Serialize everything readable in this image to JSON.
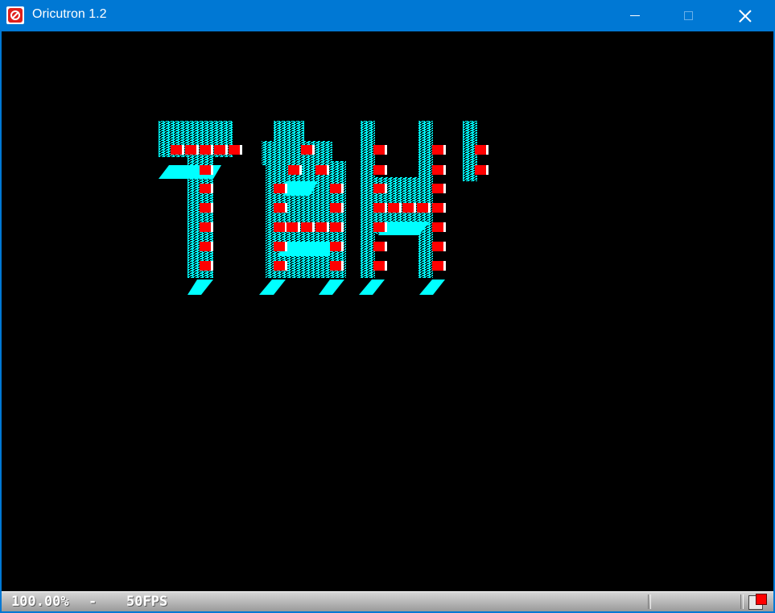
{
  "window": {
    "title": "Oricutron 1.2",
    "icon": "oricutron-app-icon"
  },
  "controls": {
    "minimize_icon": "minimize-icon",
    "maximize_icon": "maximize-icon",
    "close_icon": "close-icon"
  },
  "screen": {
    "banner_text": "TẢH",
    "colors": {
      "background": "#000000",
      "pattern": "#00ffff",
      "brick": "#ff0000",
      "highlight": "#ffffff"
    }
  },
  "status": {
    "speed": "100.00%",
    "separator": "-",
    "fps": "50FPS",
    "disk_icon": "disk-activity-icon"
  }
}
